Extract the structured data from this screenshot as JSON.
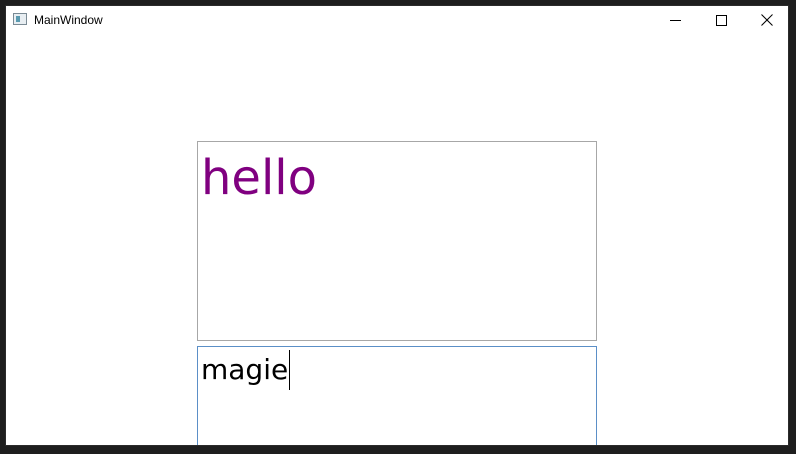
{
  "window": {
    "title": "MainWindow",
    "icon": "app-window-icon"
  },
  "titlebar_buttons": {
    "minimize_icon": "minimize-icon",
    "maximize_icon": "maximize-icon",
    "close_icon": "close-icon"
  },
  "display": {
    "text": "hello",
    "color": "#800080"
  },
  "input": {
    "value": "magie"
  }
}
